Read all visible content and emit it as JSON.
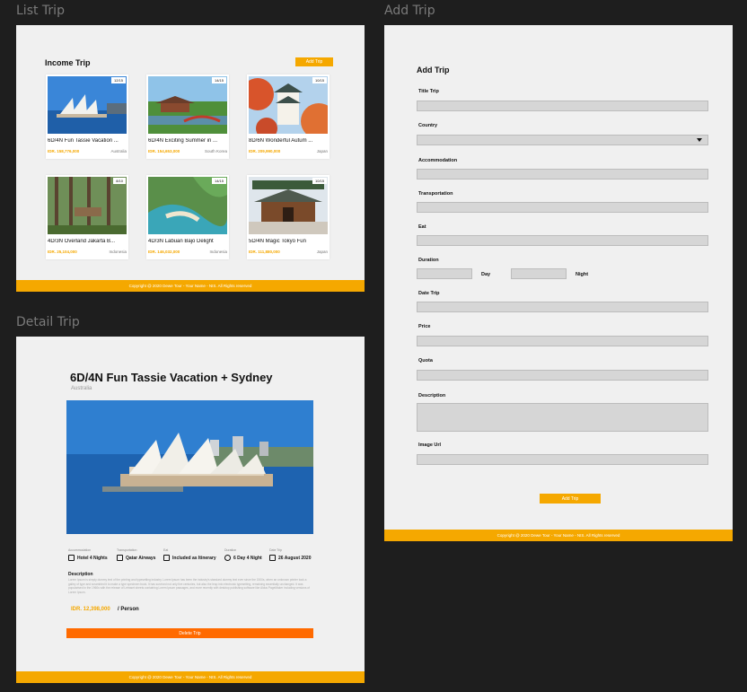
{
  "labels": {
    "list": "List Trip",
    "detail": "Detail Trip",
    "add": "Add Trip"
  },
  "footer": "Copyright @ 2020 Dewe Tour - Your Name - NIS. All Rights reserved",
  "list": {
    "title": "Income Trip",
    "add_button": "Add Trip",
    "cards": [
      {
        "title": "6D/4N Fun Tassie Vacation ...",
        "price": "IDR. 158,776,000",
        "country": "Australia",
        "badge": "12/15"
      },
      {
        "title": "6D/4N Exciting Summer in ...",
        "price": "IDR. 154,653,000",
        "country": "South Korea",
        "badge": "14/15"
      },
      {
        "title": "8D/6N Wonderful Autum ...",
        "price": "IDR. 209,990,000",
        "country": "Japan",
        "badge": "10/15"
      },
      {
        "title": "4D/3N Overland Jakarta B...",
        "price": "IDR. 25,104,000",
        "country": "Indonesia",
        "badge": "8/10"
      },
      {
        "title": "4D/3N Labuan Bajo Delight",
        "price": "IDR. 146,032,000",
        "country": "Indonesia",
        "badge": "14/15"
      },
      {
        "title": "5D/4N Magic Tokyo Fun",
        "price": "IDR. 111,880,000",
        "country": "Japan",
        "badge": "10/15"
      }
    ]
  },
  "detail": {
    "title": "6D/4N Fun Tassie Vacation + Sydney",
    "country": "Australia",
    "info": [
      {
        "label": "Accommodation",
        "value": "Hotel 4 Nights",
        "icon": "hotel-icon"
      },
      {
        "label": "Transportation",
        "value": "Qatar Airways",
        "icon": "plane-icon"
      },
      {
        "label": "Eat",
        "value": "Included as Itinerary",
        "icon": "meal-icon"
      },
      {
        "label": "Duration",
        "value": "6 Day 4 Night",
        "icon": "clock-icon"
      },
      {
        "label": "Date Trip",
        "value": "26 August 2020",
        "icon": "calendar-icon"
      }
    ],
    "description_title": "Description",
    "description": "Lorem Ipsum is simply dummy text of the printing and typesetting industry. Lorem Ipsum has been the industry's standard dummy text ever since the 1500s, when an unknown printer took a galley of type and scrambled it to make a type specimen book. It has survived not only five centuries, but also the leap into electronic typesetting, remaining essentially unchanged. It was popularised in the 1960s with the release of Letraset sheets containing Lorem Ipsum passages, and more recently with desktop publishing software like Aldus PageMaker including versions of Lorem Ipsum.",
    "price": "IDR. 12,398,000",
    "per": "/ Person",
    "delete_button": "Delete Trip"
  },
  "add": {
    "title": "Add Trip",
    "fields": {
      "title_trip": "Title Trip",
      "country": "Country",
      "accommodation": "Accommodation",
      "transportation": "Transportation",
      "eat": "Eat",
      "duration": "Duration",
      "day": "Day",
      "night": "Night",
      "date_trip": "Date Trip",
      "price": "Price",
      "quota": "Quota",
      "description": "Description",
      "image_url": "Image Url"
    },
    "submit": "Add Trip"
  },
  "colors": {
    "accent": "#f5a800",
    "danger": "#ff6a00"
  }
}
